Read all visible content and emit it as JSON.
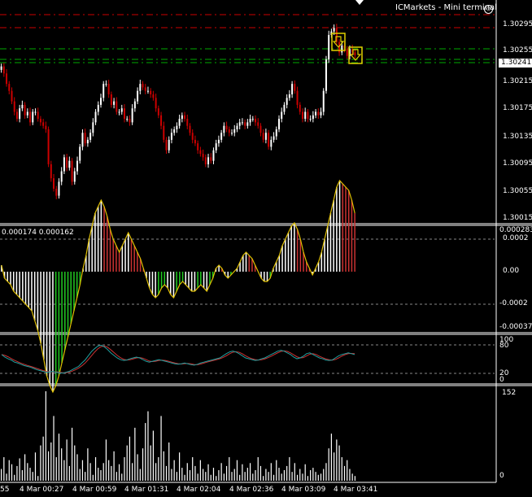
{
  "window": {
    "title": "ICMarkets - Mini terminal"
  },
  "main_chart": {
    "price_labels": [
      "1.30295",
      "1.30255",
      "1.30215",
      "1.30175",
      "1.30135",
      "1.30095",
      "1.30055",
      "1.30015"
    ],
    "current_price": "1.30241",
    "colors": {
      "up": "#ffffff",
      "down": "#cc0000",
      "level_red": "#cc0000",
      "level_green": "#00aa00"
    }
  },
  "macd": {
    "values_text": "0.000174 0.000162",
    "scale_labels": [
      "0.000283",
      "0.0002",
      "0.00",
      "-0.0002",
      "-0.00037"
    ]
  },
  "stoch": {
    "scale_labels": [
      "100",
      "80",
      "20",
      "0"
    ]
  },
  "volume": {
    "scale_labels": [
      "152",
      "0"
    ]
  },
  "time_axis": [
    "55",
    "4 Mar 00:27",
    "4 Mar 00:59",
    "4 Mar 01:31",
    "4 Mar 02:04",
    "4 Mar 02:36",
    "4 Mar 03:09",
    "4 Mar 03:41"
  ],
  "chart_data": {
    "type": "candlestick",
    "price_range": [
      1.3,
      1.3032
    ],
    "close": [
      1.30225,
      1.30215,
      1.302,
      1.3019,
      1.30175,
      1.3016,
      1.3015,
      1.30165,
      1.3017,
      1.30155,
      1.3016,
      1.30145,
      1.3016,
      1.3016,
      1.3015,
      1.30145,
      1.3014,
      1.30135,
      1.30085,
      1.30065,
      1.3005,
      1.3004,
      1.3006,
      1.30075,
      1.30095,
      1.3008,
      1.3009,
      1.3006,
      1.30075,
      1.3009,
      1.3011,
      1.3013,
      1.30115,
      1.3012,
      1.3013,
      1.30145,
      1.3016,
      1.3017,
      1.3018,
      1.302,
      1.302,
      1.30185,
      1.3017,
      1.30175,
      1.3016,
      1.3016,
      1.30165,
      1.3015,
      1.3015,
      1.30145,
      1.30165,
      1.30175,
      1.3019,
      1.302,
      1.30195,
      1.3019,
      1.3019,
      1.30185,
      1.3018,
      1.30165,
      1.30155,
      1.3014,
      1.3012,
      1.30105,
      1.3012,
      1.3013,
      1.30135,
      1.3014,
      1.3015,
      1.30155,
      1.3015,
      1.3014,
      1.3013,
      1.3012,
      1.30115,
      1.30105,
      1.301,
      1.30095,
      1.30085,
      1.30095,
      1.3009,
      1.30105,
      1.30115,
      1.3012,
      1.3013,
      1.3014,
      1.30135,
      1.3013,
      1.3013,
      1.30135,
      1.3014,
      1.30145,
      1.30145,
      1.3014,
      1.30145,
      1.3015,
      1.3015,
      1.30145,
      1.3014,
      1.3013,
      1.3012,
      1.3013,
      1.3011,
      1.3012,
      1.30125,
      1.30135,
      1.3015,
      1.3016,
      1.3017,
      1.3018,
      1.30185,
      1.302,
      1.3019,
      1.3017,
      1.3016,
      1.3015,
      1.3016,
      1.3015,
      1.3015,
      1.30155,
      1.3016,
      1.30155,
      1.3016,
      1.3019,
      1.30235,
      1.3027,
      1.30275,
      1.3028,
      1.3026,
      1.30245,
      1.30255,
      1.3025,
      1.3024,
      1.3025,
      1.30245,
      1.30241
    ],
    "volume": [
      20,
      40,
      12,
      35,
      28,
      10,
      25,
      38,
      18,
      45,
      30,
      22,
      15,
      48,
      8,
      60,
      75,
      152,
      50,
      65,
      110,
      40,
      80,
      55,
      35,
      70,
      25,
      90,
      60,
      45,
      20,
      35,
      15,
      55,
      30,
      10,
      40,
      22,
      18,
      30,
      70,
      35,
      25,
      50,
      15,
      28,
      12,
      40,
      60,
      75,
      30,
      90,
      45,
      20,
      55,
      98,
      118,
      60,
      85,
      30,
      40,
      110,
      50,
      25,
      65,
      20,
      35,
      15,
      48,
      22,
      10,
      30,
      18,
      40,
      25,
      12,
      35,
      20,
      15,
      28,
      10,
      22,
      8,
      18,
      30,
      12,
      25,
      40,
      15,
      20,
      35,
      10,
      28,
      15,
      22,
      30,
      12,
      18,
      40,
      25,
      8,
      20,
      15,
      30,
      10,
      35,
      22,
      12,
      18,
      25,
      40,
      15,
      30,
      10,
      20,
      12,
      28,
      8,
      18,
      22,
      15,
      10,
      12,
      20,
      30,
      55,
      80,
      48,
      70,
      60,
      40,
      25,
      35,
      20,
      12,
      8
    ],
    "macd_histogram": [
      2e-05,
      -2e-05,
      -3e-05,
      -4e-05,
      -6e-05,
      -7e-05,
      -8e-05,
      -9e-05,
      -0.0001,
      -0.00011,
      -0.00012,
      -0.00015,
      -0.00018,
      -0.00022,
      -0.00027,
      -0.00032,
      -0.00035,
      -0.00037,
      -0.00035,
      -0.00032,
      -0.00028,
      -0.00024,
      -0.0002,
      -0.00016,
      -0.00012,
      -8e-05,
      -4e-05,
      1e-05,
      5e-05,
      0.0001,
      0.00014,
      0.00018,
      0.0002,
      0.00022,
      0.0002,
      0.00017,
      0.00013,
      0.0001,
      8e-05,
      6e-05,
      8e-05,
      0.0001,
      0.00012,
      0.0001,
      8e-05,
      6e-05,
      4e-05,
      1e-05,
      -2e-05,
      -5e-05,
      -7e-05,
      -8e-05,
      -7e-05,
      -5e-05,
      -4e-05,
      -5e-05,
      -7e-05,
      -8e-05,
      -6e-05,
      -4e-05,
      -3e-05,
      -4e-05,
      -5e-05,
      -6e-05,
      -6e-05,
      -5e-05,
      -4e-05,
      -5e-05,
      -6e-05,
      -4e-05,
      -2e-05,
      1e-05,
      2e-05,
      1e-05,
      -1e-05,
      -2e-05,
      -1e-05,
      0,
      1e-05,
      3e-05,
      5e-05,
      6e-05,
      5e-05,
      4e-05,
      2e-05,
      0,
      -2e-05,
      -3e-05,
      -3e-05,
      -2e-05,
      1e-05,
      3e-05,
      5e-05,
      8e-05,
      0.0001,
      0.00012,
      0.00014,
      0.00015,
      0.00013,
      0.0001,
      6e-05,
      3e-05,
      1e-05,
      -1e-05,
      1e-05,
      3e-05,
      6e-05,
      0.0001,
      0.00014,
      0.00018,
      0.00022,
      0.00026,
      0.00028,
      0.00027,
      0.00026,
      0.00025,
      0.00022,
      0.00018
    ],
    "stoch": [
      58,
      52,
      48,
      45,
      40,
      38,
      35,
      32,
      30,
      28,
      25,
      22,
      20,
      18,
      16,
      17,
      18,
      16,
      15,
      14,
      16,
      18,
      22,
      26,
      30,
      38,
      45,
      55,
      65,
      72,
      78,
      80,
      76,
      70,
      62,
      56,
      50,
      46,
      44,
      45,
      48,
      50,
      52,
      50,
      46,
      42,
      40,
      42,
      44,
      46,
      44,
      42,
      40,
      38,
      36,
      35,
      36,
      38,
      36,
      34,
      33,
      35,
      38,
      40,
      42,
      44,
      46,
      48,
      50,
      55,
      60,
      64,
      66,
      64,
      60,
      55,
      50,
      48,
      46,
      44,
      45,
      48,
      50,
      54,
      58,
      62,
      66,
      68,
      66,
      62,
      58,
      52,
      48,
      50,
      54,
      60,
      62,
      58,
      54,
      50,
      48,
      45,
      44,
      45,
      50,
      55,
      58,
      60,
      62,
      60,
      58
    ]
  }
}
